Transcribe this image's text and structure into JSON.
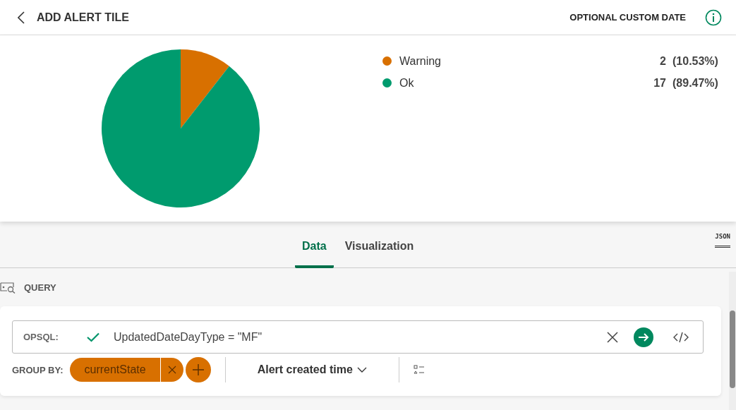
{
  "header": {
    "title": "ADD ALERT TILE",
    "custom_date": "OPTIONAL CUSTOM DATE"
  },
  "chart": {
    "chart_data": {
      "type": "pie",
      "categories": [
        "Warning",
        "Ok"
      ],
      "values": [
        10.53,
        89.47
      ]
    },
    "legend": [
      {
        "value": "2",
        "percent": "(10.53%)",
        "color": "#d87000"
      },
      {
        "value": "17",
        "percent": "(89.47%)",
        "color": "#009b6e"
      }
    ]
  },
  "tabs": [
    {
      "label": "Data",
      "selected": true
    },
    {
      "label": "Visualization",
      "selected": false
    }
  ],
  "json_button": "JSON",
  "query": {
    "section_title": "QUERY",
    "opsql_label": "OPSQL:",
    "valid": true,
    "expression": "UpdatedDateDayType = \"MF\"",
    "group_by_label": "GROUP BY:",
    "group_by": [
      {
        "label": "currentState"
      }
    ],
    "time_field": "Alert created time"
  }
}
